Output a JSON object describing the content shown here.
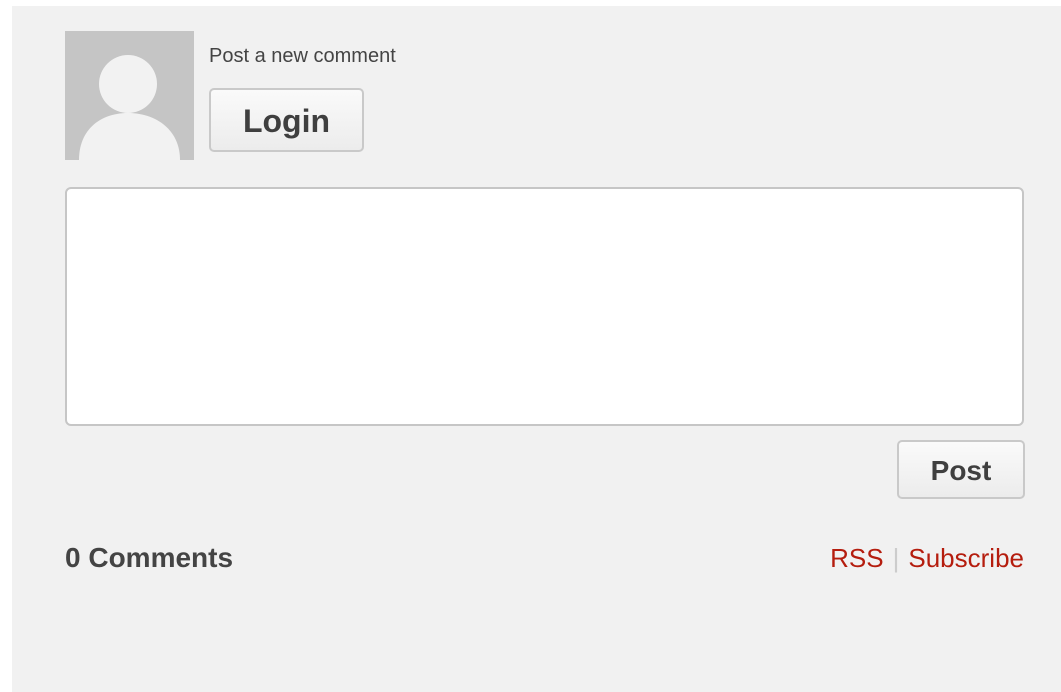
{
  "comment_form": {
    "heading": "Post a new comment",
    "login_label": "Login",
    "comment_placeholder": "",
    "post_label": "Post"
  },
  "comments": {
    "count_label": "0 Comments"
  },
  "feed_links": {
    "rss_label": "RSS",
    "separator": "|",
    "subscribe_label": "Subscribe"
  },
  "colors": {
    "panel_bg": "#f1f1f1",
    "avatar_bg": "#c5c5c5",
    "link": "#b51d0e",
    "text": "#444444"
  },
  "icons": {
    "avatar": "default-user-silhouette-icon"
  }
}
